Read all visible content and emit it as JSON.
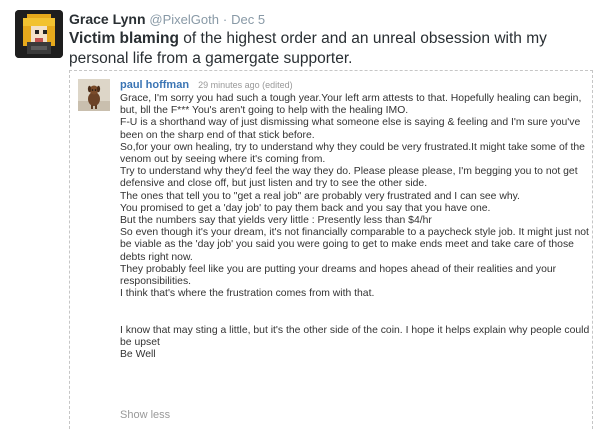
{
  "tweet": {
    "author_name": "Grace Lynn",
    "author_handle": "@PixelGoth",
    "separator": "·",
    "date": "Dec 5",
    "text_bold": "Victim blaming",
    "text_rest": " of the highest order and an unreal obsession with my personal life from a gamergate supporter."
  },
  "quote": {
    "author": "paul hoffman",
    "time": "29 minutes ago (edited)",
    "lines": [
      "Grace, I'm sorry you had such a tough year.Your left arm attests to that. Hopefully healing can begin, but, bll the F*** You's aren't going to help with the healing IMO.",
      "F-U is a shorthand way of just dismissing what someone else is saying & feeling and I'm sure you've been on the sharp end of that stick before.",
      "So,for your own healing, try to understand why they could be very frustrated.It might take some of the venom out by seeing where it's coming from.",
      "Try to understand why they'd feel the way they do.  Please please please, I'm begging you to not get defensive and close off, but just listen and try to see the other side.",
      "The ones that tell you to \"get a real job\" are probably very frustrated and I can see why.",
      "You promised to get a 'day job' to pay them back and you say that you have one.",
      "But the numbers say that yields very little : Presently less than $4/hr",
      "So even though it's your dream, it's not financially comparable to a paycheck style job.  It might just not be viable as the 'day job' you said you were going to get to make ends meet and take care of those debts right now.",
      "They probably feel like you are putting your dreams and hopes ahead of their realities and your responsibilities.",
      "I think that's where the frustration comes from with that."
    ],
    "closing_lines": [
      "I know that may sting a little, but it's the other side of the coin.  I hope it helps explain why people could be upset",
      "Be Well"
    ],
    "show_less": "Show less"
  }
}
